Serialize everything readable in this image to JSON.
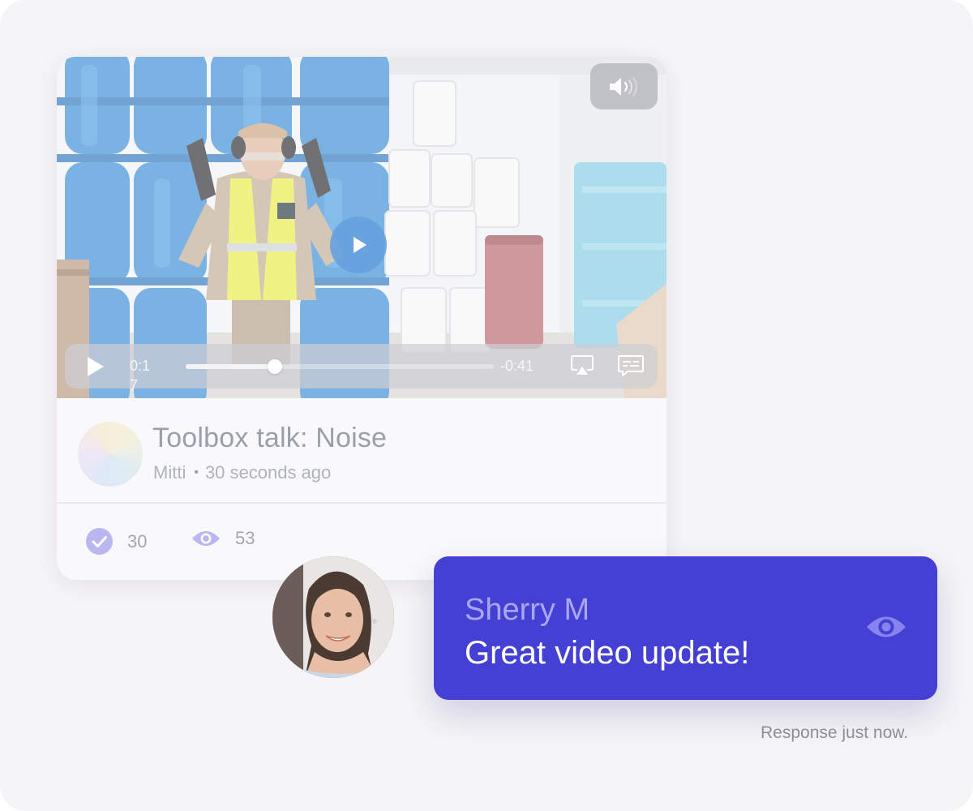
{
  "post": {
    "title": "Toolbox talk: Noise",
    "author": "Mitti",
    "separator": "•",
    "posted_time": "30 seconds ago",
    "acknowledgements": "30",
    "views": "53"
  },
  "video": {
    "elapsed": "0:17",
    "remaining": "-0:41",
    "progress_fraction": 0.29
  },
  "response": {
    "name": "Sherry M",
    "message": "Great video update!",
    "status": "Response just now."
  },
  "icons": {
    "mute": "speaker-icon",
    "play": "play-icon",
    "airplay": "airplay-icon",
    "captions": "captions-icon",
    "acknowledged": "check-circle-icon",
    "views": "eye-icon"
  },
  "colors": {
    "accent": "#4440d4",
    "accent_light": "#a9a7f3",
    "background": "#f5f4f6"
  }
}
